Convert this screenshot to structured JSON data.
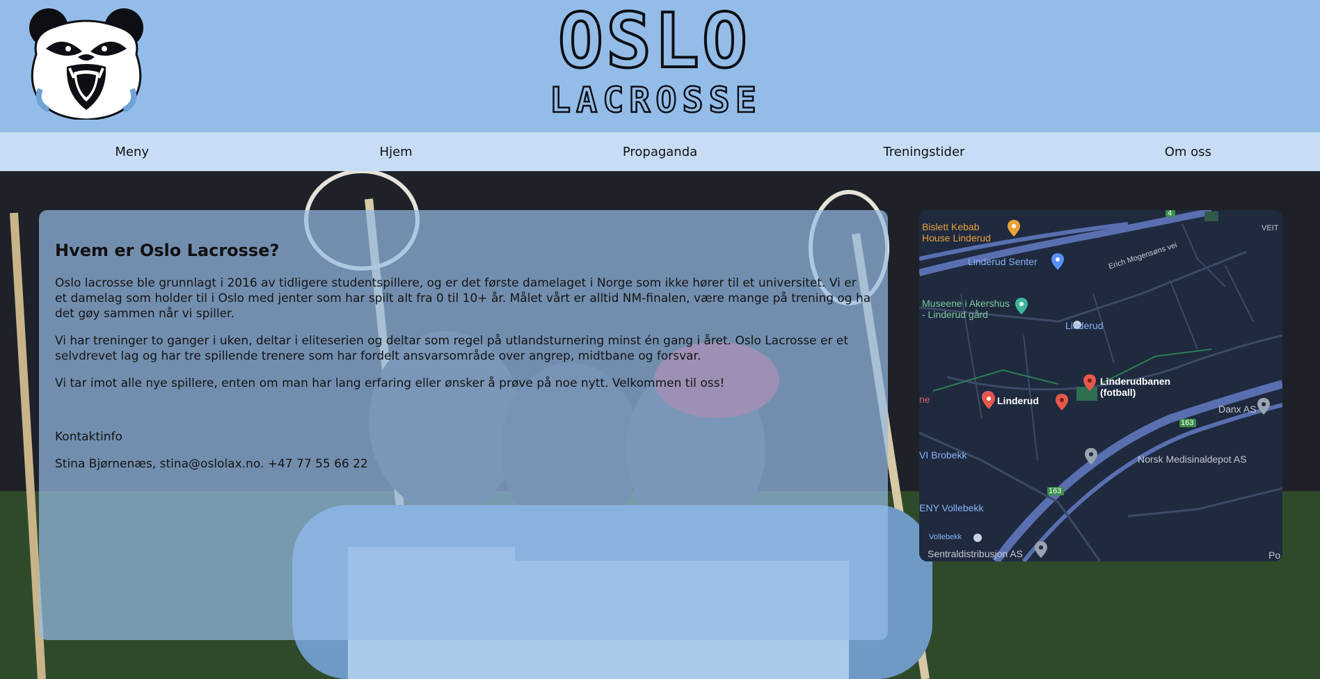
{
  "brand": {
    "line1": "OSLO",
    "line2": "LACROSSE"
  },
  "nav": [
    {
      "label": "Meny"
    },
    {
      "label": "Hjem"
    },
    {
      "label": "Propaganda"
    },
    {
      "label": "Treningstider"
    },
    {
      "label": "Om oss"
    }
  ],
  "about": {
    "title": "Hvem er Oslo Lacrosse?",
    "paragraphs": [
      "Oslo lacrosse ble grunnlagt i 2016 av tidligere studentspillere, og er det første damelaget i Norge som ikke hører til et universitet. Vi er et damelag som holder til i Oslo med jenter som har spilt alt fra 0 til 10+ år. Målet vårt er alltid NM-finalen, være mange på trening og ha det gøy sammen når vi spiller.",
      "Vi har treninger to ganger i uken, deltar i eliteserien og deltar som regel på utlandsturnering minst én gang i året. Oslo Lacrosse er et selvdrevet lag og har tre spillende trenere som har fordelt ansvarsområde over angrep, midtbane og forsvar.",
      "Vi tar imot alle nye spillere, enten om man har lang erfaring eller ønsker å prøve på noe nytt. Velkommen til oss!"
    ],
    "contact_heading": "Kontaktinfo",
    "contact_line": "Stina Bjørnenæs, stina@oslolax.no. +47 77 55 66 22"
  },
  "map": {
    "labels": {
      "biskett": "Bislett Kebab",
      "biskett2": "House Linderud",
      "senter": "Linderud Senter",
      "erich": "Erich Mogensøns vei",
      "museene1": "Museene i Akershus",
      "museene2": "- Linderud gård",
      "linderud_station": "Linderud",
      "linderudbanen1": "Linderudbanen",
      "linderudbanen2": "(fotball)",
      "linderud": "Linderud",
      "ne": "ne",
      "danx": "Danx AS",
      "brobekk": "VI Brobekk",
      "norsk": "Norsk Medisinaldepot AS",
      "eny": "ENY Vollebekk",
      "vollebekk": "Vollebekk",
      "sentral": "Sentraldistribusjon AS",
      "veit": "VEIT",
      "po": "Po",
      "road4": "4",
      "road163a": "163",
      "road163b": "163"
    }
  },
  "colors": {
    "header_bg": "#93bde8",
    "nav_bg": "#c6ddf5",
    "panel_bg": "rgba(150,188,232,0.70)",
    "map_bg": "#1f2a3f"
  },
  "icons": [
    "panda-logo",
    "map-pin-icon",
    "restaurant-icon",
    "shop-icon",
    "museum-icon",
    "hotel-icon",
    "train-station-icon"
  ]
}
